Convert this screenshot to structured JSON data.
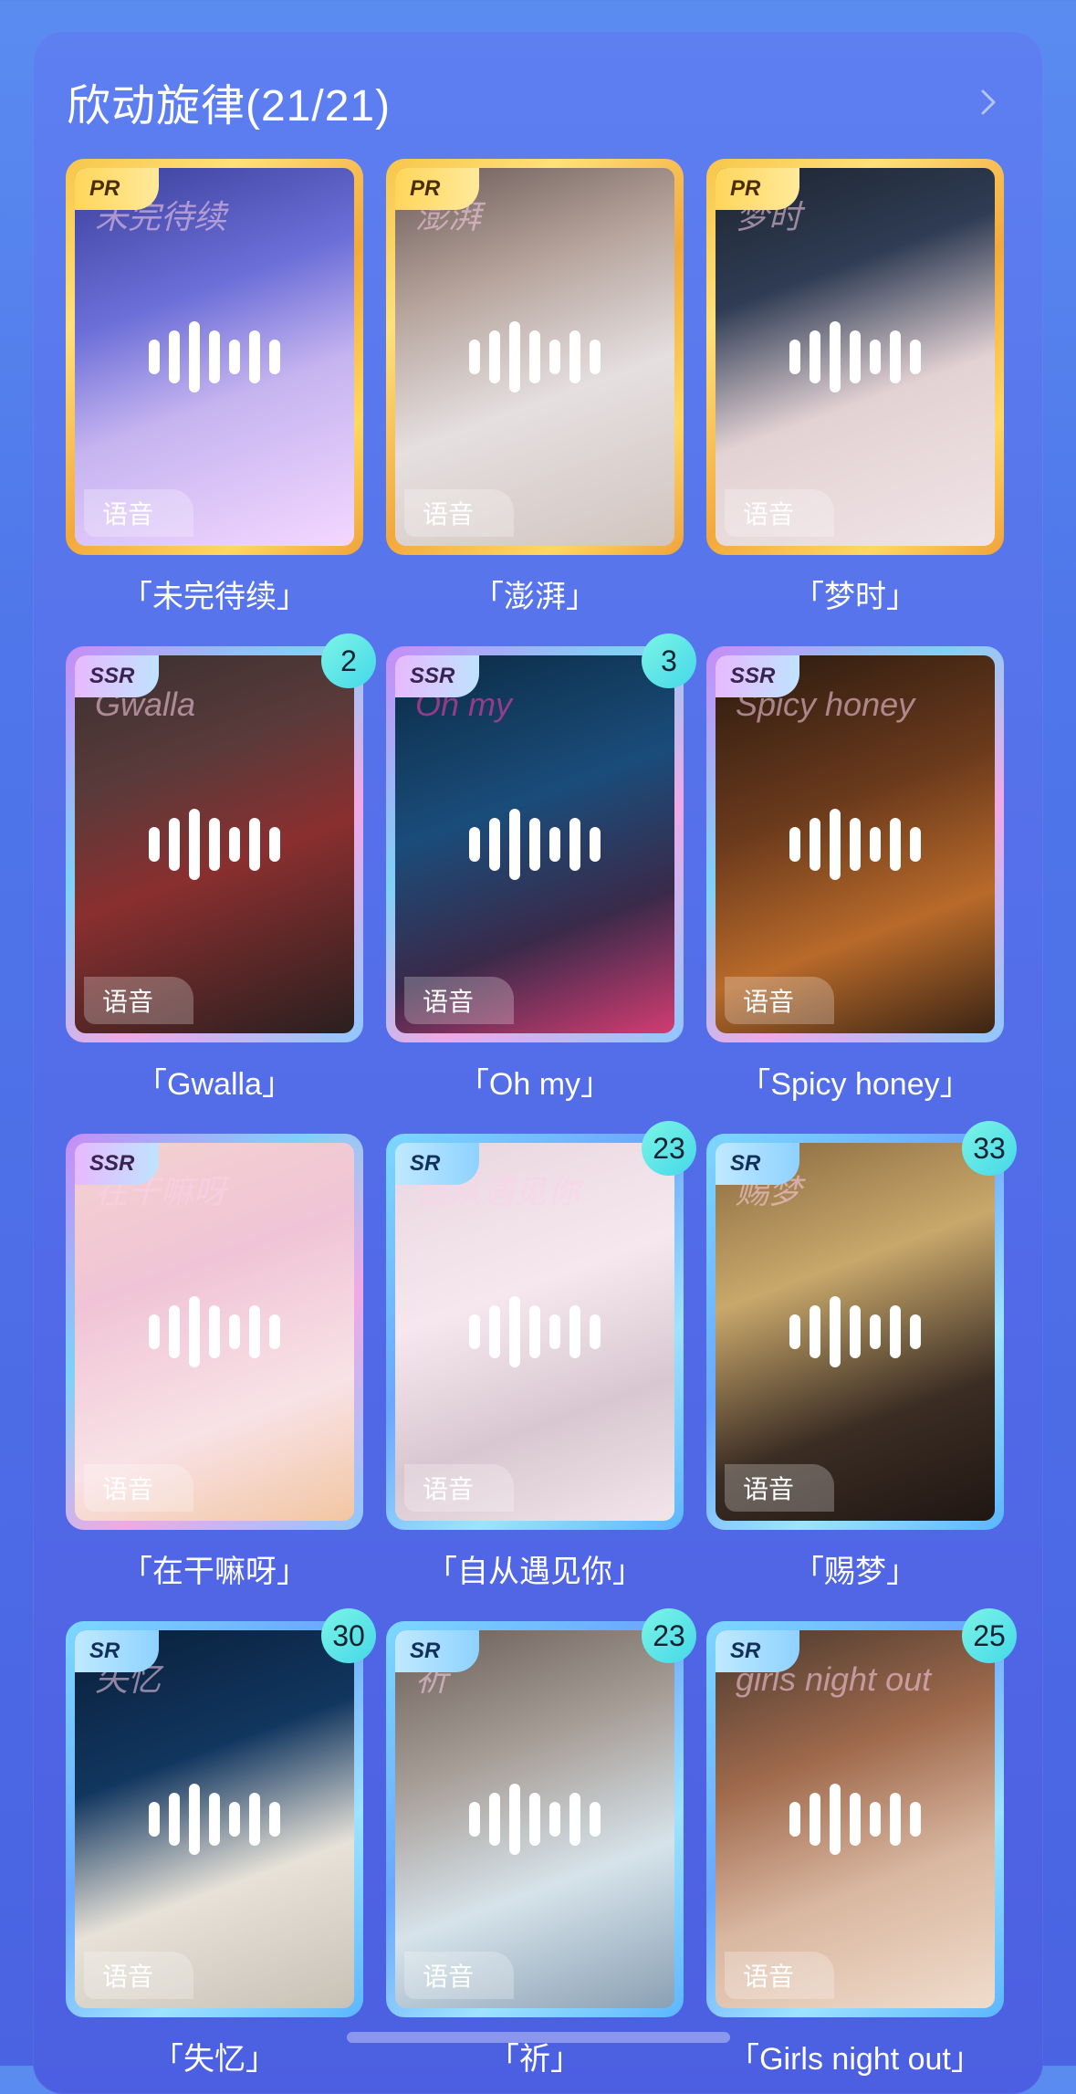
{
  "header": {
    "title": "欣动旋律(21/21)"
  },
  "cards": [
    {
      "rarity": "PR",
      "label": "「未完待续」",
      "voice": "语音",
      "theme": "pr",
      "count": "",
      "bg": "linear-gradient(160deg,#3a3f9a 0%,#6c6fd8 35%,#c6b4f0 60%,#f3d7ff 100%)",
      "artText": "未完待续"
    },
    {
      "rarity": "PR",
      "label": "「澎湃」",
      "voice": "语音",
      "theme": "pr",
      "count": "",
      "bg": "linear-gradient(160deg,#6b5a57 0%,#b5a39b 30%,#e5dfe0 60%,#d2c5bf 100%)",
      "artText": "澎湃"
    },
    {
      "rarity": "PR",
      "label": "「梦时」",
      "voice": "语音",
      "theme": "pr",
      "count": "",
      "bg": "linear-gradient(160deg,#1d2530 0%,#2f3c54 30%,#e3d2d4 60%,#f0e4e6 100%)",
      "artText": "梦时"
    },
    {
      "rarity": "SSR",
      "label": "「Gwalla」",
      "voice": "语音",
      "theme": "ssr",
      "count": "2",
      "bg": "linear-gradient(160deg,#3a3030 0%,#5a3a3a 30%,#8a2f2f 55%,#2a1f1f 100%)",
      "artText": "Gwalla"
    },
    {
      "rarity": "SSR",
      "label": "「Oh my」",
      "voice": "语音",
      "theme": "ssr",
      "count": "3",
      "bg": "linear-gradient(160deg,#0b2b44 0%,#1a4c7a 40%,#3a2a4a 70%,#d23c72 100%)",
      "artText": "Oh my"
    },
    {
      "rarity": "SSR",
      "label": "「Spicy honey」",
      "voice": "语音",
      "theme": "ssr",
      "count": "",
      "bg": "linear-gradient(160deg,#2a1a10 0%,#6b3a1c 40%,#b86a2a 70%,#3a2414 100%)",
      "artText": "Spicy honey"
    },
    {
      "rarity": "SSR",
      "label": "「在干嘛呀」",
      "voice": "语音",
      "theme": "ssr",
      "count": "",
      "bg": "linear-gradient(160deg,#f3d2cf 0%,#f0c4d6 35%,#f8e2e6 70%,#f2c6a2 100%)",
      "artText": "在干嘛呀"
    },
    {
      "rarity": "SR",
      "label": "「自从遇见你」",
      "voice": "语音",
      "theme": "sr",
      "count": "23",
      "bg": "linear-gradient(160deg,#e8d6de 0%,#f6e7ee 40%,#d8c7d0 70%,#f2e5ea 100%)",
      "artText": "自从遇见你"
    },
    {
      "rarity": "SR",
      "label": "「赐梦」",
      "voice": "语音",
      "theme": "sr",
      "count": "33",
      "bg": "linear-gradient(160deg,#8a6a40 0%,#c9a86b 35%,#3b2d24 70%,#201612 100%)",
      "artText": "赐梦"
    },
    {
      "rarity": "SR",
      "label": "「失忆」",
      "voice": "语音",
      "theme": "sr",
      "count": "30",
      "bg": "linear-gradient(160deg,#0a1f3a 0%,#11365f 35%,#e7e2d8 65%,#c7c1b6 100%)",
      "artText": "失忆"
    },
    {
      "rarity": "SR",
      "label": "「祈」",
      "voice": "语音",
      "theme": "sr",
      "count": "23",
      "bg": "linear-gradient(160deg,#6b5f58 0%,#a9a09a 35%,#d6e3ea 65%,#8aa0b4 100%)",
      "artText": "祈"
    },
    {
      "rarity": "SR",
      "label": "「Girls night out」",
      "voice": "语音",
      "theme": "sr",
      "count": "25",
      "bg": "linear-gradient(160deg,#4b3a2e 0%,#a06a4d 35%,#d9b7a0 65%,#f0dccc 100%)",
      "artText": "girls night out"
    }
  ]
}
